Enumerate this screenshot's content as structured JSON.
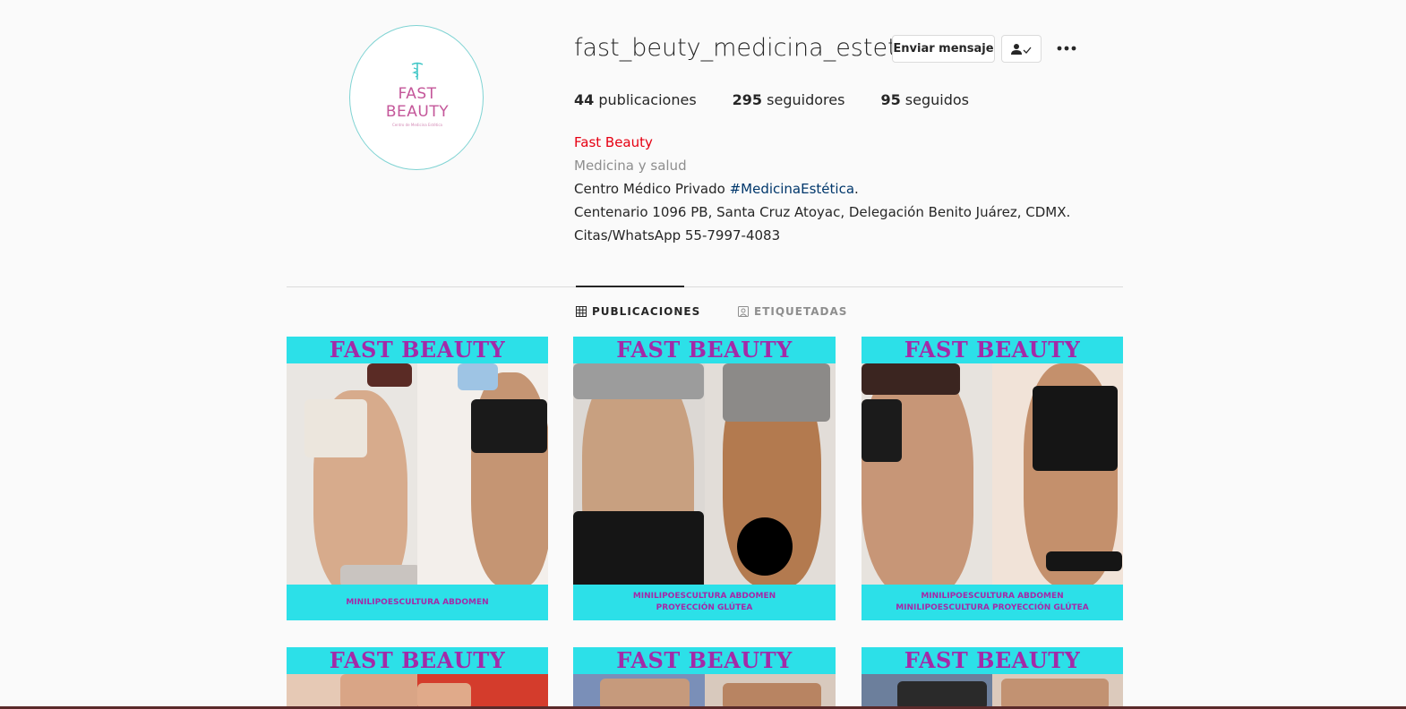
{
  "profile": {
    "username": "fast_beuty_medicina_estetica",
    "avatar": {
      "line1": "FAST",
      "line2": "BEAUTY",
      "tagline": "Centro de Medicina Estética"
    },
    "buttons": {
      "message": "Enviar mensaje",
      "follow_icon": "person-check-icon",
      "more_icon": "more-dots-icon"
    },
    "stats": [
      {
        "count": "44",
        "label": "publicaciones"
      },
      {
        "count": "295",
        "label": "seguidores"
      },
      {
        "count": "95",
        "label": "seguidos"
      }
    ],
    "bio": {
      "name": "Fast Beauty",
      "category": "Medicina y salud",
      "line1_prefix": "Centro Médico Privado ",
      "line1_hashtag": "#MedicinaEstética",
      "line1_suffix": ".",
      "line2": "Centenario 1096 PB, Santa Cruz Atoyac, Delegación Benito Juárez, CDMX.",
      "line3": "Citas/WhatsApp 55-7997-4083"
    }
  },
  "tabs": [
    {
      "label": "PUBLICACIONES",
      "icon": "grid-icon",
      "active": true
    },
    {
      "label": "ETIQUETADAS",
      "icon": "tagged-icon",
      "active": false
    }
  ],
  "posts": [
    {
      "banner": "FAST BEAUTY",
      "caption1": "MINILIPOESCULTURA ABDOMEN",
      "caption2": ""
    },
    {
      "banner": "FAST BEAUTY",
      "caption1": "MINILIPOESCULTURA ABDOMEN",
      "caption2": "PROYECCIÓN GLÚTEA"
    },
    {
      "banner": "FAST BEAUTY",
      "caption1": "MINILIPOESCULTURA ABDOMEN",
      "caption2": "MINILIPOESCULTURA PROYECCIÓN GLÚTEA"
    },
    {
      "banner": "FAST BEAUTY"
    },
    {
      "banner": "FAST BEAUTY"
    },
    {
      "banner": "FAST BEAUTY"
    }
  ],
  "colors": {
    "accent_name": "#e60012",
    "hashtag": "#00376b",
    "banner_bg": "#2ce0e8",
    "banner_text": "#a32aa8"
  }
}
